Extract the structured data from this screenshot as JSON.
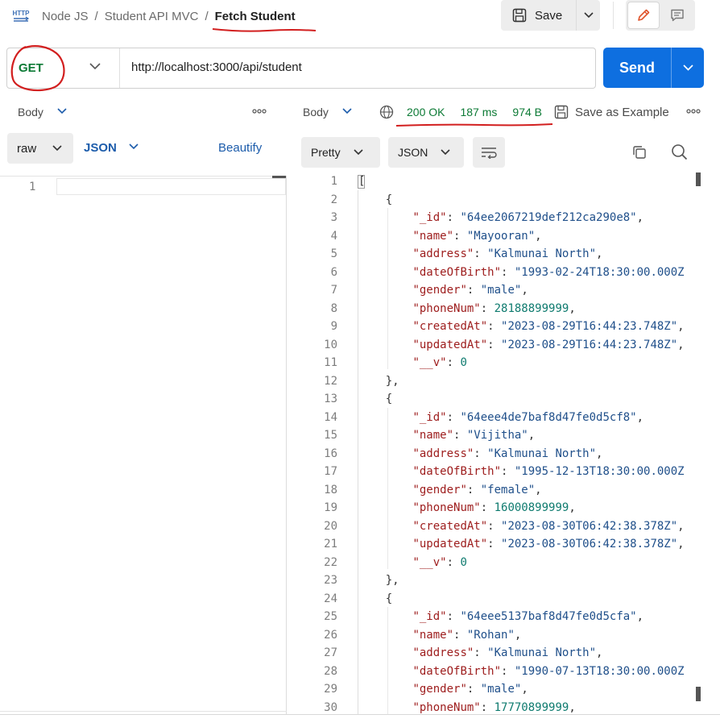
{
  "header": {
    "breadcrumbs": [
      "Node JS",
      "Student API MVC"
    ],
    "separator": "/",
    "current": "Fetch Student",
    "save_label": "Save",
    "icon_label": "HTTP"
  },
  "request": {
    "method": "GET",
    "url": "http://localhost:3000/api/student",
    "send_label": "Send"
  },
  "left_pane": {
    "tab": "Body",
    "more": "ooo",
    "body_type": "raw",
    "format": "JSON",
    "beautify": "Beautify",
    "line_number": "1"
  },
  "right_pane": {
    "tab": "Body",
    "status": "200 OK",
    "time": "187 ms",
    "size": "974 B",
    "save_example": "Save as Example",
    "more": "ooo",
    "view_mode": "Pretty",
    "format": "JSON"
  },
  "colors": {
    "method_green": "#0c7a35",
    "send_blue": "#0e6fe0",
    "annotation_red": "#d21f1f",
    "key_red": "#9d1c1c",
    "string_blue": "#1f4f8a",
    "number_teal": "#0f7b6f"
  },
  "code_lines": [
    {
      "n": "1",
      "parts": [
        [
          "p",
          "["
        ]
      ]
    },
    {
      "n": "2",
      "parts": [
        [
          "p",
          "    {"
        ]
      ]
    },
    {
      "n": "3",
      "parts": [
        [
          "p",
          "        "
        ],
        [
          "k",
          "\"_id\""
        ],
        [
          "p",
          ": "
        ],
        [
          "s",
          "\"64ee2067219def212ca290e8\""
        ],
        [
          "p",
          ","
        ]
      ]
    },
    {
      "n": "4",
      "parts": [
        [
          "p",
          "        "
        ],
        [
          "k",
          "\"name\""
        ],
        [
          "p",
          ": "
        ],
        [
          "s",
          "\"Mayooran\""
        ],
        [
          "p",
          ","
        ]
      ]
    },
    {
      "n": "5",
      "parts": [
        [
          "p",
          "        "
        ],
        [
          "k",
          "\"address\""
        ],
        [
          "p",
          ": "
        ],
        [
          "s",
          "\"Kalmunai North\""
        ],
        [
          "p",
          ","
        ]
      ]
    },
    {
      "n": "6",
      "parts": [
        [
          "p",
          "        "
        ],
        [
          "k",
          "\"dateOfBirth\""
        ],
        [
          "p",
          ": "
        ],
        [
          "s",
          "\"1993-02-24T18:30:00.000Z"
        ]
      ]
    },
    {
      "n": "7",
      "parts": [
        [
          "p",
          "        "
        ],
        [
          "k",
          "\"gender\""
        ],
        [
          "p",
          ": "
        ],
        [
          "s",
          "\"male\""
        ],
        [
          "p",
          ","
        ]
      ]
    },
    {
      "n": "8",
      "parts": [
        [
          "p",
          "        "
        ],
        [
          "k",
          "\"phoneNum\""
        ],
        [
          "p",
          ": "
        ],
        [
          "n",
          "28188899999"
        ],
        [
          "p",
          ","
        ]
      ]
    },
    {
      "n": "9",
      "parts": [
        [
          "p",
          "        "
        ],
        [
          "k",
          "\"createdAt\""
        ],
        [
          "p",
          ": "
        ],
        [
          "s",
          "\"2023-08-29T16:44:23.748Z\""
        ],
        [
          "p",
          ","
        ]
      ]
    },
    {
      "n": "10",
      "parts": [
        [
          "p",
          "        "
        ],
        [
          "k",
          "\"updatedAt\""
        ],
        [
          "p",
          ": "
        ],
        [
          "s",
          "\"2023-08-29T16:44:23.748Z\""
        ],
        [
          "p",
          ","
        ]
      ]
    },
    {
      "n": "11",
      "parts": [
        [
          "p",
          "        "
        ],
        [
          "k",
          "\"__v\""
        ],
        [
          "p",
          ": "
        ],
        [
          "n",
          "0"
        ]
      ]
    },
    {
      "n": "12",
      "parts": [
        [
          "p",
          "    },"
        ]
      ]
    },
    {
      "n": "13",
      "parts": [
        [
          "p",
          "    {"
        ]
      ]
    },
    {
      "n": "14",
      "parts": [
        [
          "p",
          "        "
        ],
        [
          "k",
          "\"_id\""
        ],
        [
          "p",
          ": "
        ],
        [
          "s",
          "\"64eee4de7baf8d47fe0d5cf8\""
        ],
        [
          "p",
          ","
        ]
      ]
    },
    {
      "n": "15",
      "parts": [
        [
          "p",
          "        "
        ],
        [
          "k",
          "\"name\""
        ],
        [
          "p",
          ": "
        ],
        [
          "s",
          "\"Vijitha\""
        ],
        [
          "p",
          ","
        ]
      ]
    },
    {
      "n": "16",
      "parts": [
        [
          "p",
          "        "
        ],
        [
          "k",
          "\"address\""
        ],
        [
          "p",
          ": "
        ],
        [
          "s",
          "\"Kalmunai North\""
        ],
        [
          "p",
          ","
        ]
      ]
    },
    {
      "n": "17",
      "parts": [
        [
          "p",
          "        "
        ],
        [
          "k",
          "\"dateOfBirth\""
        ],
        [
          "p",
          ": "
        ],
        [
          "s",
          "\"1995-12-13T18:30:00.000Z"
        ]
      ]
    },
    {
      "n": "18",
      "parts": [
        [
          "p",
          "        "
        ],
        [
          "k",
          "\"gender\""
        ],
        [
          "p",
          ": "
        ],
        [
          "s",
          "\"female\""
        ],
        [
          "p",
          ","
        ]
      ]
    },
    {
      "n": "19",
      "parts": [
        [
          "p",
          "        "
        ],
        [
          "k",
          "\"phoneNum\""
        ],
        [
          "p",
          ": "
        ],
        [
          "n",
          "16000899999"
        ],
        [
          "p",
          ","
        ]
      ]
    },
    {
      "n": "20",
      "parts": [
        [
          "p",
          "        "
        ],
        [
          "k",
          "\"createdAt\""
        ],
        [
          "p",
          ": "
        ],
        [
          "s",
          "\"2023-08-30T06:42:38.378Z\""
        ],
        [
          "p",
          ","
        ]
      ]
    },
    {
      "n": "21",
      "parts": [
        [
          "p",
          "        "
        ],
        [
          "k",
          "\"updatedAt\""
        ],
        [
          "p",
          ": "
        ],
        [
          "s",
          "\"2023-08-30T06:42:38.378Z\""
        ],
        [
          "p",
          ","
        ]
      ]
    },
    {
      "n": "22",
      "parts": [
        [
          "p",
          "        "
        ],
        [
          "k",
          "\"__v\""
        ],
        [
          "p",
          ": "
        ],
        [
          "n",
          "0"
        ]
      ]
    },
    {
      "n": "23",
      "parts": [
        [
          "p",
          "    },"
        ]
      ]
    },
    {
      "n": "24",
      "parts": [
        [
          "p",
          "    {"
        ]
      ]
    },
    {
      "n": "25",
      "parts": [
        [
          "p",
          "        "
        ],
        [
          "k",
          "\"_id\""
        ],
        [
          "p",
          ": "
        ],
        [
          "s",
          "\"64eee5137baf8d47fe0d5cfa\""
        ],
        [
          "p",
          ","
        ]
      ]
    },
    {
      "n": "26",
      "parts": [
        [
          "p",
          "        "
        ],
        [
          "k",
          "\"name\""
        ],
        [
          "p",
          ": "
        ],
        [
          "s",
          "\"Rohan\""
        ],
        [
          "p",
          ","
        ]
      ]
    },
    {
      "n": "27",
      "parts": [
        [
          "p",
          "        "
        ],
        [
          "k",
          "\"address\""
        ],
        [
          "p",
          ": "
        ],
        [
          "s",
          "\"Kalmunai North\""
        ],
        [
          "p",
          ","
        ]
      ]
    },
    {
      "n": "28",
      "parts": [
        [
          "p",
          "        "
        ],
        [
          "k",
          "\"dateOfBirth\""
        ],
        [
          "p",
          ": "
        ],
        [
          "s",
          "\"1990-07-13T18:30:00.000Z"
        ]
      ]
    },
    {
      "n": "29",
      "parts": [
        [
          "p",
          "        "
        ],
        [
          "k",
          "\"gender\""
        ],
        [
          "p",
          ": "
        ],
        [
          "s",
          "\"male\""
        ],
        [
          "p",
          ","
        ]
      ]
    },
    {
      "n": "30",
      "parts": [
        [
          "p",
          "        "
        ],
        [
          "k",
          "\"phoneNum\""
        ],
        [
          "p",
          ": "
        ],
        [
          "n",
          "17770899999"
        ],
        [
          "p",
          ","
        ]
      ]
    }
  ]
}
